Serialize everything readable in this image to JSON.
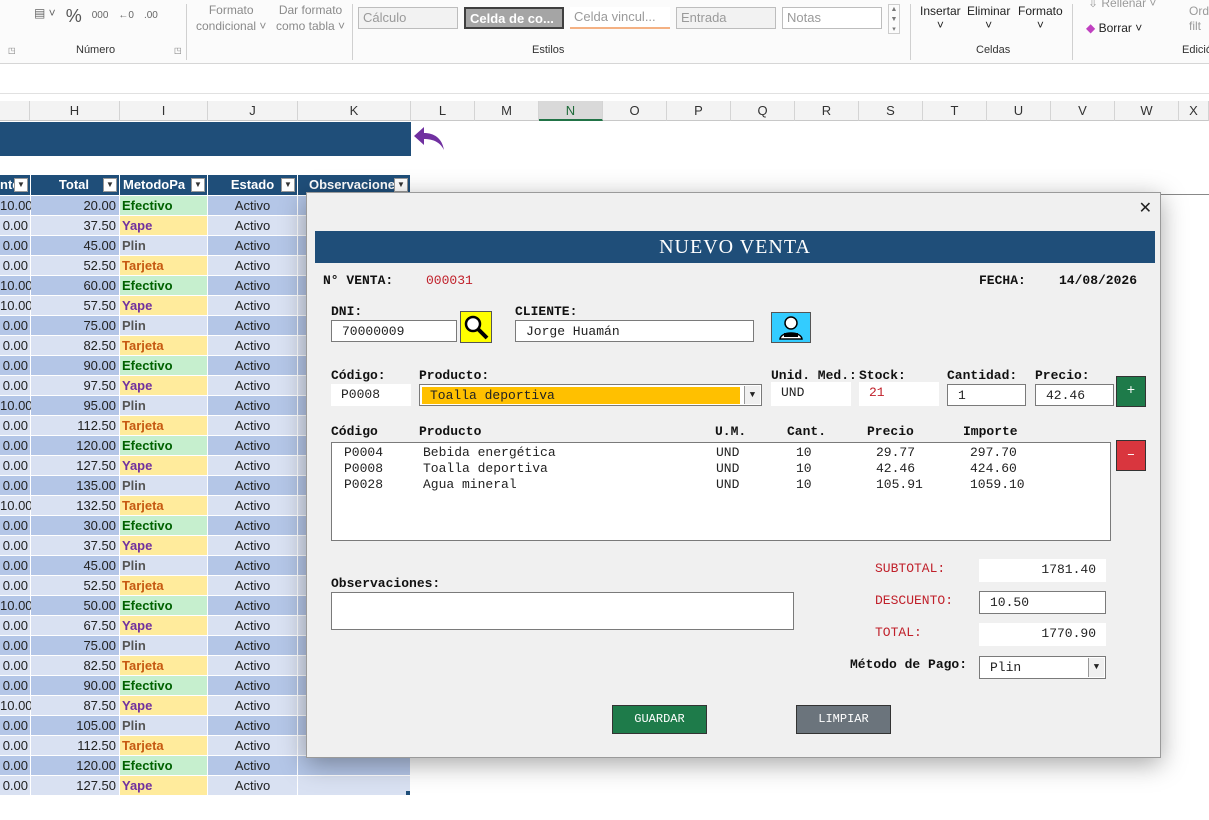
{
  "ribbon": {
    "numero_label": "Número",
    "percent": "%",
    "thousands": "000",
    "formato_condicional": [
      "Formato",
      "condicional"
    ],
    "dar_formato": [
      "Dar formato",
      "como tabla"
    ],
    "styles": [
      "Cálculo",
      "Celda de co...",
      "Celda vincul...",
      "Entrada",
      "Notas"
    ],
    "estilos_label": "Estilos",
    "insertar": "Insertar",
    "eliminar": "Eliminar",
    "formato": "Formato",
    "celdas_label": "Celdas",
    "rellenar": "Rellenar",
    "borrar": "Borrar",
    "ord": "Ord",
    "filt": "filt",
    "edicion_label": "Edició"
  },
  "columns": [
    "H",
    "I",
    "J",
    "K",
    "L",
    "M",
    "N",
    "O",
    "P",
    "Q",
    "R",
    "S",
    "T",
    "U",
    "V",
    "W",
    "X"
  ],
  "table": {
    "headers": [
      "nte",
      "Total",
      "MetodoPa",
      "Estado",
      "Observacione"
    ],
    "rows": [
      [
        "10.00",
        "20.00",
        "Efectivo",
        "Activo"
      ],
      [
        "0.00",
        "37.50",
        "Yape",
        "Activo"
      ],
      [
        "0.00",
        "45.00",
        "Plin",
        "Activo"
      ],
      [
        "0.00",
        "52.50",
        "Tarjeta",
        "Activo"
      ],
      [
        "10.00",
        "60.00",
        "Efectivo",
        "Activo"
      ],
      [
        "10.00",
        "57.50",
        "Yape",
        "Activo"
      ],
      [
        "0.00",
        "75.00",
        "Plin",
        "Activo"
      ],
      [
        "0.00",
        "82.50",
        "Tarjeta",
        "Activo"
      ],
      [
        "0.00",
        "90.00",
        "Efectivo",
        "Activo"
      ],
      [
        "0.00",
        "97.50",
        "Yape",
        "Activo"
      ],
      [
        "10.00",
        "95.00",
        "Plin",
        "Activo"
      ],
      [
        "0.00",
        "112.50",
        "Tarjeta",
        "Activo"
      ],
      [
        "0.00",
        "120.00",
        "Efectivo",
        "Activo"
      ],
      [
        "0.00",
        "127.50",
        "Yape",
        "Activo"
      ],
      [
        "0.00",
        "135.00",
        "Plin",
        "Activo"
      ],
      [
        "10.00",
        "132.50",
        "Tarjeta",
        "Activo"
      ],
      [
        "0.00",
        "30.00",
        "Efectivo",
        "Activo"
      ],
      [
        "0.00",
        "37.50",
        "Yape",
        "Activo"
      ],
      [
        "0.00",
        "45.00",
        "Plin",
        "Activo"
      ],
      [
        "0.00",
        "52.50",
        "Tarjeta",
        "Activo"
      ],
      [
        "10.00",
        "50.00",
        "Efectivo",
        "Activo"
      ],
      [
        "0.00",
        "67.50",
        "Yape",
        "Activo"
      ],
      [
        "0.00",
        "75.00",
        "Plin",
        "Activo"
      ],
      [
        "0.00",
        "82.50",
        "Tarjeta",
        "Activo"
      ],
      [
        "0.00",
        "90.00",
        "Efectivo",
        "Activo"
      ],
      [
        "10.00",
        "87.50",
        "Yape",
        "Activo"
      ],
      [
        "0.00",
        "105.00",
        "Plin",
        "Activo"
      ],
      [
        "0.00",
        "112.50",
        "Tarjeta",
        "Activo"
      ],
      [
        "0.00",
        "120.00",
        "Efectivo",
        "Activo"
      ],
      [
        "0.00",
        "127.50",
        "Yape",
        "Activo"
      ]
    ]
  },
  "dialog": {
    "title": "NUEVO VENTA",
    "venta_label": "N° VENTA:",
    "venta_value": "000031",
    "fecha_label": "FECHA:",
    "fecha_value": "14/08/2026",
    "dni_label": "DNI:",
    "dni_value": "70000009",
    "cliente_label": "CLIENTE:",
    "cliente_value": "Jorge Huamán",
    "codigo_label": "Código:",
    "codigo_value": "P0008",
    "producto_label": "Producto:",
    "producto_value": "Toalla deportiva",
    "unid_label": "Unid. Med.:",
    "unid_value": "UND",
    "stock_label": "Stock:",
    "stock_value": "21",
    "cantidad_label": "Cantidad:",
    "cantidad_value": "1",
    "precio_label": "Precio:",
    "precio_value": "42.46",
    "add_label": "+",
    "remove_label": "–",
    "list_headers": [
      "Código",
      "Producto",
      "U.M.",
      "Cant.",
      "Precio",
      "Importe"
    ],
    "items": [
      [
        "P0004",
        "Bebida energética",
        "UND",
        "10",
        "29.77",
        "297.70"
      ],
      [
        "P0008",
        "Toalla deportiva",
        "UND",
        "10",
        "42.46",
        "424.60"
      ],
      [
        "P0028",
        "Agua mineral",
        "UND",
        "10",
        "105.91",
        "1059.10"
      ]
    ],
    "observaciones_label": "Observaciones:",
    "observaciones_value": "",
    "subtotal_label": "SUBTOTAL:",
    "subtotal_value": "1781.40",
    "descuento_label": "DESCUENTO:",
    "descuento_value": "10.50",
    "total_label": "TOTAL:",
    "total_value": "1770.90",
    "metodo_label": "Método de Pago:",
    "metodo_value": "Plin",
    "guardar_label": "GUARDAR",
    "limpiar_label": "LIMPIAR"
  },
  "colors": {
    "header_blue": "#1f4e79",
    "guardar_green": "#1e7b4a",
    "limpiar_gray": "#6b747c",
    "add_green": "#1e7b4a",
    "remove_red": "#d9363e",
    "producto_highlight": "#ffc000"
  }
}
